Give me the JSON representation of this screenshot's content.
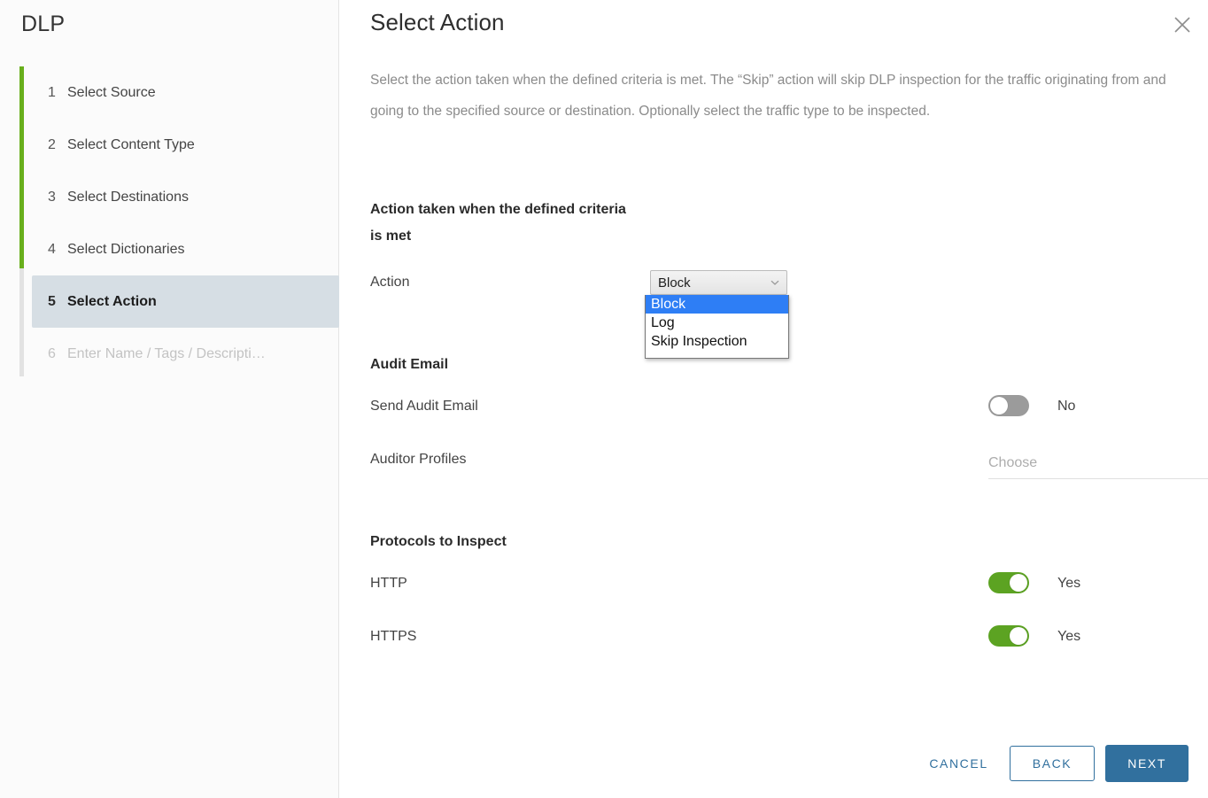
{
  "sidebar": {
    "title": "DLP",
    "steps": [
      {
        "num": "1",
        "label": "Select Source",
        "state": "done"
      },
      {
        "num": "2",
        "label": "Select Content Type",
        "state": "done"
      },
      {
        "num": "3",
        "label": "Select Destinations",
        "state": "done"
      },
      {
        "num": "4",
        "label": "Select Dictionaries",
        "state": "done"
      },
      {
        "num": "5",
        "label": "Select Action",
        "state": "active"
      },
      {
        "num": "6",
        "label": "Enter Name / Tags / Descripti…",
        "state": "disabled"
      }
    ],
    "progress_color": "#68af1c",
    "rail_inactive_color": "#e2e2e2",
    "active_background": "#d6dee4"
  },
  "header": {
    "title": "Select Action",
    "close_icon": "close-icon"
  },
  "description": "Select the action taken when the defined criteria is met. The “Skip” action will skip DLP inspection for the traffic originating from and going to the specified source or destination. Optionally select the traffic type to be inspected.",
  "sections": {
    "action": {
      "title": "Action taken when the defined criteria is met",
      "field_label": "Action",
      "selected_value": "Block",
      "options": [
        "Block",
        "Log",
        "Skip Inspection"
      ],
      "highlight_color": "#2e7ef5",
      "open": true
    },
    "audit": {
      "title": "Audit Email",
      "send_audit_email": {
        "label": "Send Audit Email",
        "state": "No",
        "on": false
      },
      "auditor_profiles": {
        "label": "Auditor Profiles",
        "placeholder": "Choose"
      }
    },
    "protocols": {
      "title": "Protocols to Inspect",
      "rows": [
        {
          "label": "HTTP",
          "state": "Yes",
          "on": true
        },
        {
          "label": "HTTPS",
          "state": "Yes",
          "on": true
        }
      ],
      "on_color": "#5ca322",
      "off_color": "#9b9b9b"
    }
  },
  "footer": {
    "cancel_label": "CANCEL",
    "back_label": "BACK",
    "next_label": "NEXT",
    "accent_color": "#31709e"
  }
}
